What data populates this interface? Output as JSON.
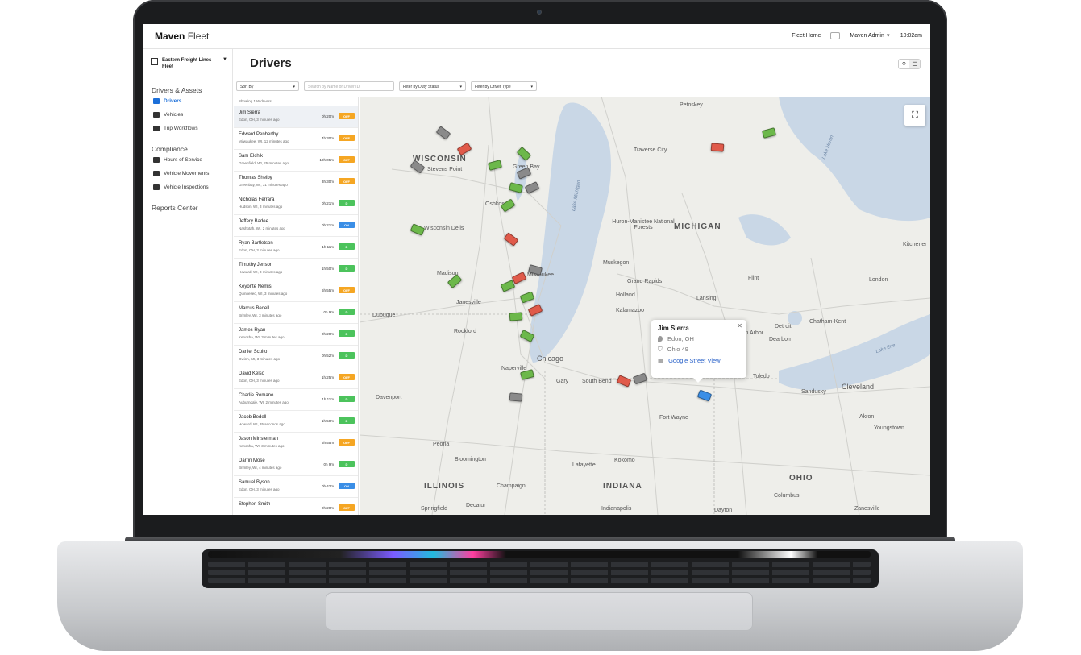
{
  "app": {
    "brand_bold": "Maven",
    "brand_light": "Fleet"
  },
  "topnav": {
    "home": "Fleet Home",
    "user": "Maven Admin",
    "time": "10:02am"
  },
  "sidebar": {
    "fleet": "Eastern Freight Lines Fleet",
    "sections": [
      {
        "title": "Drivers & Assets",
        "items": [
          "Drivers",
          "Vehicles",
          "Trip Workflows"
        ]
      },
      {
        "title": "Compliance",
        "items": [
          "Hours of Service",
          "Vehicle Movements",
          "Vehicle Inspections"
        ]
      },
      {
        "title": "Reports Center",
        "items": []
      }
    ]
  },
  "page": {
    "title": "Drivers"
  },
  "filters": {
    "sort": "Sort By",
    "search_placeholder": "Search by Name or Driver ID",
    "duty": "Filter by Duty Status",
    "type": "Filter by Driver Type"
  },
  "list": {
    "count_text": "Showing 166 drivers",
    "drivers": [
      {
        "name": "Jim Sierra",
        "loc": "Edon, OH, 3 minutes ago",
        "hrs": "0h 20m",
        "status": "OFF"
      },
      {
        "name": "Edward Penberthy",
        "loc": "Milwaukee, WI, 12 minutes ago",
        "hrs": "4h 30m",
        "status": "OFF"
      },
      {
        "name": "Sam Elchik",
        "loc": "Greenfield, WI, 25 minutes ago",
        "hrs": "10h 05m",
        "status": "OFF"
      },
      {
        "name": "Thomas Shelby",
        "loc": "Greenbay, WI, 31 minutes ago",
        "hrs": "3h 30m",
        "status": "OFF"
      },
      {
        "name": "Nicholas Ferrara",
        "loc": "Hudson, WI, 3 minutes ago",
        "hrs": "0h 21m",
        "status": "D"
      },
      {
        "name": "Jeffery Badee",
        "loc": "Nashotah, WI, 2 minutes ago",
        "hrs": "0h 21m",
        "status": "ON"
      },
      {
        "name": "Ryan Bartletson",
        "loc": "Edon, OH, 3 minutes ago",
        "hrs": "1h 11m",
        "status": "D"
      },
      {
        "name": "Timothy Jenson",
        "loc": "Howard, WI, 3 minutes ago",
        "hrs": "1h 50m",
        "status": "D"
      },
      {
        "name": "Keyonte Nemis",
        "loc": "Quinnesec, WI, 3 minutes ago",
        "hrs": "6h 55m",
        "status": "OFF"
      },
      {
        "name": "Marcus Bedell",
        "loc": "Brimley, WI, 3 minutes ago",
        "hrs": "0h 9m",
        "status": "D"
      },
      {
        "name": "James Ryan",
        "loc": "Kenosha, WI, 3 minutes ago",
        "hrs": "0h 20m",
        "status": "D"
      },
      {
        "name": "Daniel Scuito",
        "loc": "Gwinn, MI, 3 minutes ago",
        "hrs": "0h 52m",
        "status": "D"
      },
      {
        "name": "David Kelso",
        "loc": "Edon, OH, 3 minutes ago",
        "hrs": "1h 25m",
        "status": "OFF"
      },
      {
        "name": "Charlie Romano",
        "loc": "Auburndale, WI, 2 minutes ago",
        "hrs": "1h 11m",
        "status": "D"
      },
      {
        "name": "Jacob Bedell",
        "loc": "Howard, WI, 35 seconds ago",
        "hrs": "1h 50m",
        "status": "D"
      },
      {
        "name": "Jason Minsterman",
        "loc": "Kenosha, WI, 3 minutes ago",
        "hrs": "6h 55m",
        "status": "OFF"
      },
      {
        "name": "Darrin Mose",
        "loc": "Brimley, WI, 4 minutes ago",
        "hrs": "0h 9m",
        "status": "D"
      },
      {
        "name": "Samuel Byson",
        "loc": "Edon, OH, 3 minutes ago",
        "hrs": "0h 42m",
        "status": "ON"
      },
      {
        "name": "Stephen Smith",
        "loc": "",
        "hrs": "0h 20m",
        "status": "OFF"
      }
    ]
  },
  "status_colors": {
    "OFF": "#f5a623",
    "D": "#4cc35c",
    "ON": "#3a8ee6"
  },
  "map": {
    "states": [
      "WISCONSIN",
      "MICHIGAN",
      "ILLINOIS",
      "INDIANA",
      "OHIO"
    ],
    "lake": "Lake Michigan",
    "cities": [
      "Petoskey",
      "Traverse City",
      "Stevens Point",
      "Green Bay",
      "Oshkosh",
      "Wisconsin Dells",
      "Madison",
      "Milwaukee",
      "Janesville",
      "Rockford",
      "Dubuque",
      "Chicago",
      "Naperville",
      "Gary",
      "South Bend",
      "Toledo",
      "Detroit",
      "Flint",
      "Lansing",
      "Grand Rapids",
      "Holland",
      "Muskegon",
      "Huron-Manistee National Forests",
      "Ann Arbor",
      "Dearborn",
      "Chatham-Kent",
      "London",
      "Kitchener",
      "Cleveland",
      "Akron",
      "Youngstown",
      "Fort Wayne",
      "Kokomo",
      "Lafayette",
      "Bloomington",
      "Peoria",
      "Champaign",
      "Decatur",
      "Springfield",
      "Indianapolis",
      "Columbus",
      "Dayton",
      "Zanesville",
      "Davenport",
      "Sandusky",
      "Lake Erie",
      "Lake Huron",
      "Kalamazoo"
    ],
    "popup": {
      "name": "Jim Sierra",
      "city": "Edon, OH",
      "road": "Ohio 49",
      "link": "Google Street View"
    }
  }
}
